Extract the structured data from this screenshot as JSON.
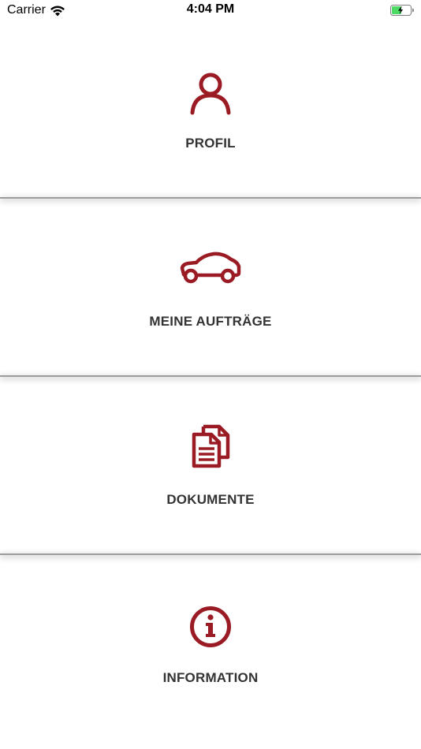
{
  "status_bar": {
    "carrier": "Carrier",
    "time": "4:04 PM",
    "icons": [
      "wifi-icon",
      "battery-charging-icon"
    ]
  },
  "menu": {
    "accent_color": "#9a1b24",
    "items": [
      {
        "label": "PROFIL",
        "icon": "user-icon"
      },
      {
        "label": "MEINE AUFTRÄGE",
        "icon": "car-icon"
      },
      {
        "label": "DOKUMENTE",
        "icon": "documents-icon"
      },
      {
        "label": "INFORMATION",
        "icon": "info-icon"
      }
    ]
  }
}
